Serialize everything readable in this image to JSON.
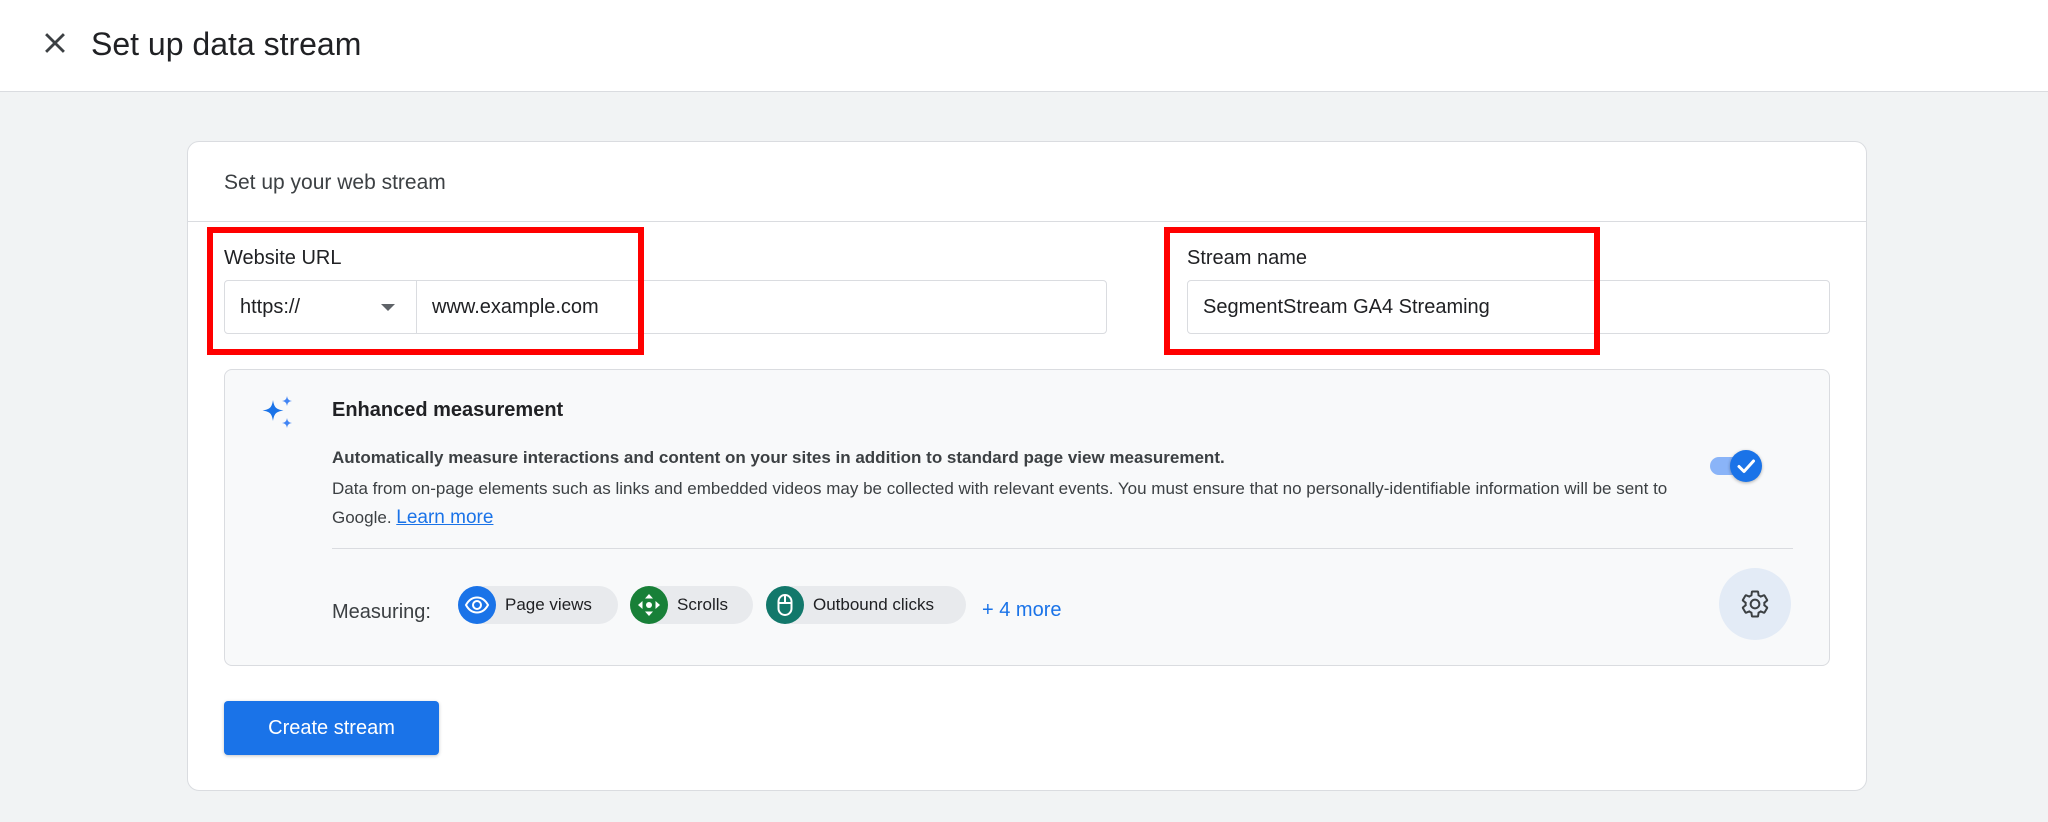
{
  "header": {
    "title": "Set up data stream",
    "close_icon": "close-icon"
  },
  "card": {
    "title": "Set up your web stream"
  },
  "website_url": {
    "label": "Website URL",
    "protocol": "https://",
    "value": "www.example.com"
  },
  "stream_name": {
    "label": "Stream name",
    "value": "SegmentStream GA4 Streaming"
  },
  "enhanced_measurement": {
    "icon": "sparkle-icon",
    "title": "Enhanced measurement",
    "description_bold": "Automatically measure interactions and content on your sites in addition to standard page view measurement.",
    "description": "Data from on-page elements such as links and embedded videos may be collected with relevant events. You must ensure that no personally-identifiable information will be sent to Google.",
    "learn_more": "Learn more",
    "enabled": true,
    "measuring_label": "Measuring:",
    "chips": [
      {
        "label": "Page views",
        "icon": "eye-icon",
        "color": "#1a73e8"
      },
      {
        "label": "Scrolls",
        "icon": "scroll-icon",
        "color": "#188038"
      },
      {
        "label": "Outbound clicks",
        "icon": "mouse-icon",
        "color": "#12786b"
      }
    ],
    "more_link": "+ 4 more",
    "settings_icon": "gear-icon"
  },
  "actions": {
    "create_label": "Create stream"
  },
  "colors": {
    "primary": "#1a73e8",
    "highlight": "#ff0000"
  }
}
